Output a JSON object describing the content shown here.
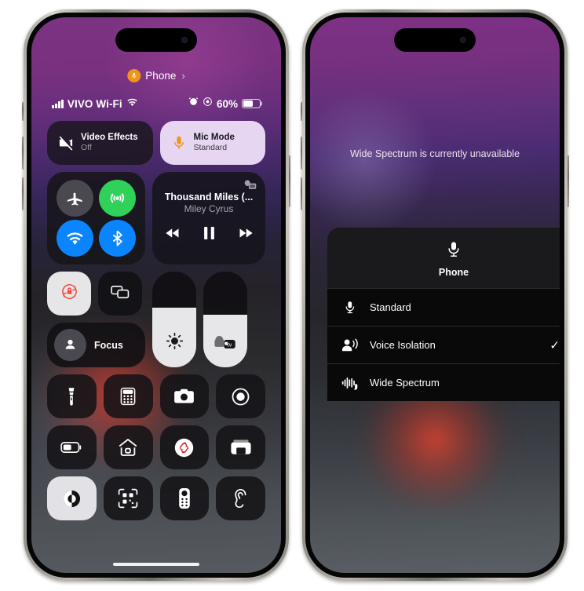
{
  "left_phone": {
    "call_banner": {
      "label": "Phone",
      "chevron": "›",
      "icon": "microphone-icon"
    },
    "status_bar": {
      "carrier": "VIVO Wi-Fi",
      "battery_percent": "60%",
      "battery_level": 60,
      "icons": [
        "cellular-signal-icon",
        "wifi-icon",
        "alarm-clock-icon",
        "focus-icon",
        "battery-icon"
      ]
    },
    "effects": [
      {
        "name": "video-effects",
        "title": "Video Effects",
        "subtitle": "Off",
        "icon": "video-camera-slash-icon",
        "active": false
      },
      {
        "name": "mic-mode",
        "title": "Mic Mode",
        "subtitle": "Standard",
        "icon": "microphone-icon",
        "active": true
      }
    ],
    "connectivity": [
      {
        "name": "airplane-mode",
        "icon": "airplane-icon",
        "state": "off"
      },
      {
        "name": "cellular-data",
        "icon": "cellular-tower-icon",
        "state": "on"
      },
      {
        "name": "wifi",
        "icon": "wifi-icon",
        "state": "on"
      },
      {
        "name": "bluetooth",
        "icon": "bluetooth-icon",
        "state": "on"
      }
    ],
    "media": {
      "title": "Thousand Miles (...",
      "artist": "Miley Cyrus",
      "airplay_icon": "airplay-audio-icon",
      "controls": [
        "rewind-icon",
        "pause-icon",
        "fast-forward-icon"
      ]
    },
    "toggles": [
      {
        "name": "rotation-lock",
        "icon": "rotation-lock-icon",
        "active": true
      },
      {
        "name": "screen-mirroring",
        "icon": "screen-mirroring-icon",
        "active": false
      }
    ],
    "focus": {
      "label": "Focus",
      "icon": "person-icon"
    },
    "sliders": [
      {
        "name": "brightness-slider",
        "icon": "sun-icon",
        "value": 62
      },
      {
        "name": "volume-slider",
        "icon": "apple-tv-output-icon",
        "value": 55
      }
    ],
    "shortcuts": [
      {
        "name": "flashlight",
        "icon": "flashlight-icon",
        "active": false
      },
      {
        "name": "calculator",
        "icon": "calculator-icon",
        "active": false
      },
      {
        "name": "camera",
        "icon": "camera-icon",
        "active": false
      },
      {
        "name": "screen-recording",
        "icon": "record-icon",
        "active": false
      },
      {
        "name": "low-power-mode",
        "icon": "low-battery-icon",
        "active": false
      },
      {
        "name": "home",
        "icon": "house-icon",
        "active": false
      },
      {
        "name": "shazam",
        "icon": "shazam-icon",
        "active": false
      },
      {
        "name": "wallet",
        "icon": "wallet-icon",
        "active": false
      },
      {
        "name": "dark-mode",
        "icon": "dark-mode-icon",
        "active": true
      },
      {
        "name": "code-scanner",
        "icon": "qr-scanner-icon",
        "active": false
      },
      {
        "name": "apple-tv-remote",
        "icon": "remote-icon",
        "active": false
      },
      {
        "name": "hearing",
        "icon": "ear-icon",
        "active": false
      }
    ]
  },
  "right_phone": {
    "toast": "Wide Spectrum is currently unavailable",
    "menu": {
      "header_label": "Phone",
      "header_icon": "microphone-icon",
      "items": [
        {
          "label": "Standard",
          "icon": "microphone-icon",
          "checked": false
        },
        {
          "label": "Voice Isolation",
          "icon": "voice-isolation-icon",
          "checked": true
        },
        {
          "label": "Wide Spectrum",
          "icon": "waveform-icon",
          "checked": false
        }
      ],
      "check_glyph": "✓"
    }
  },
  "colors": {
    "accent_orange": "#f09419",
    "green": "#30d158",
    "blue": "#0a84ff",
    "red": "#ff453a",
    "mic_mode_tile": "#e6d6f2"
  }
}
